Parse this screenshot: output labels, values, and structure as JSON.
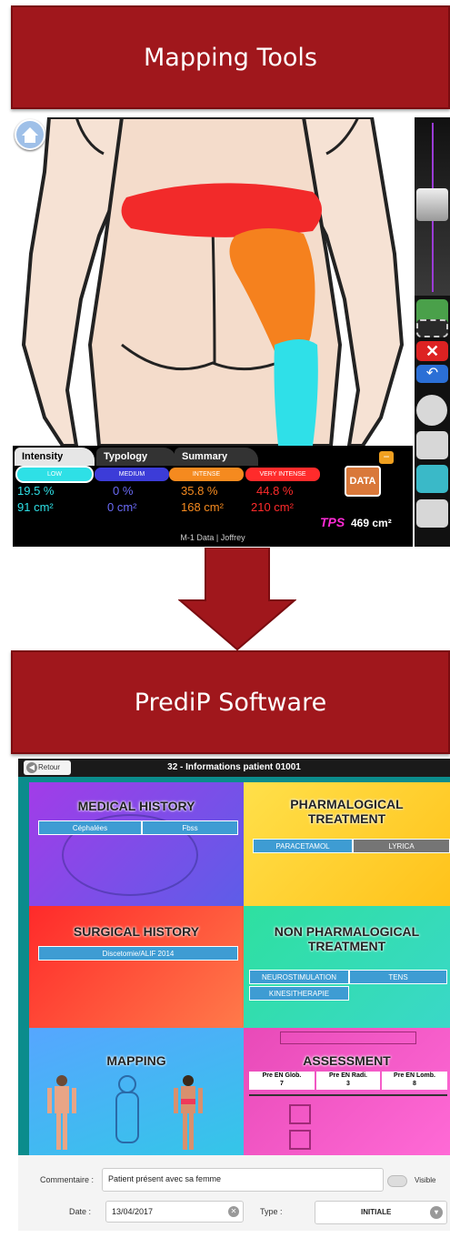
{
  "banner_top": {
    "title": "Mapping Tools"
  },
  "banner_bottom": {
    "title": "PrediP Software"
  },
  "mapping": {
    "tabs": [
      "Intensity",
      "Typology",
      "Summary"
    ],
    "levels": [
      {
        "label": "LOW",
        "pct": "19.5 %",
        "area": "91 cm²",
        "color": "#2ee0e6"
      },
      {
        "label": "MEDIUM",
        "pct": "0 %",
        "area": "0 cm²",
        "color": "#3c3cd8"
      },
      {
        "label": "INTENSE",
        "pct": "35.8 %",
        "area": "168 cm²",
        "color": "#f58a1f"
      },
      {
        "label": "VERY INTENSE",
        "pct": "44.8 %",
        "area": "210 cm²",
        "color": "#ff2b2b"
      }
    ],
    "data_button": "DATA",
    "logo": "TPS",
    "total_area": "469 cm²",
    "footer": "M-1 Data | Joffrey"
  },
  "predip": {
    "back": "Retour",
    "title": "32 - Informations patient 01001",
    "medical_history": {
      "title": "MEDICAL HISTORY",
      "chips": [
        "Céphalées",
        "Fbss"
      ]
    },
    "pharmacological": {
      "title": "PHARMALOGICAL TREATMENT",
      "chips": [
        "PARACETAMOL",
        "LYRICA"
      ]
    },
    "surgical_history": {
      "title": "SURGICAL HISTORY",
      "chips": [
        "Discetomie/ALIF 2014"
      ]
    },
    "non_pharmacological": {
      "title": "NON PHARMALOGICAL TREATMENT",
      "chips": [
        "NEUROSTIMULATION",
        "TENS",
        "KINESITHERAPIE"
      ]
    },
    "mapping_title": "MAPPING",
    "assessment": {
      "title": "ASSESSMENT",
      "scores": [
        {
          "label": "Pre EN Glob.",
          "value": "7"
        },
        {
          "label": "Pre EN Radi.",
          "value": "3"
        },
        {
          "label": "Pre EN Lomb.",
          "value": "8"
        }
      ]
    },
    "comment_label": "Commentaire :",
    "comment_value": "Patient présent avec sa femme",
    "visible_label": "Visible",
    "date_label": "Date :",
    "date_value": "13/04/2017",
    "type_label": "Type :",
    "type_value": "INITIALE"
  }
}
